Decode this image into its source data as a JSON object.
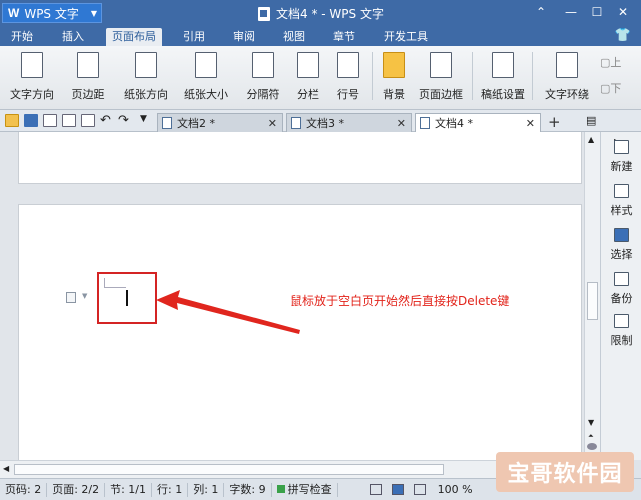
{
  "app": {
    "logo": "W",
    "name": "WPS 文字"
  },
  "window": {
    "title": "文档4 * - WPS 文字"
  },
  "menu": [
    {
      "label": "开始"
    },
    {
      "label": "插入"
    },
    {
      "label": "页面布局"
    },
    {
      "label": "引用"
    },
    {
      "label": "审阅"
    },
    {
      "label": "视图"
    },
    {
      "label": "章节"
    },
    {
      "label": "开发工具"
    }
  ],
  "active_menu": "页面布局",
  "ribbon": [
    {
      "label": "文字方向",
      "icon": "text-direction-icon"
    },
    {
      "label": "页边距",
      "icon": "page-margin-icon"
    },
    {
      "label": "纸张方向",
      "icon": "paper-orientation-icon"
    },
    {
      "label": "纸张大小",
      "icon": "paper-size-icon"
    },
    {
      "label": "分隔符",
      "icon": "separator-icon"
    },
    {
      "label": "分栏",
      "icon": "columns-icon"
    },
    {
      "label": "行号",
      "icon": "line-number-icon"
    },
    {
      "label": "背景",
      "icon": "background-icon"
    },
    {
      "label": "页面边框",
      "icon": "page-border-icon"
    },
    {
      "label": "稿纸设置",
      "icon": "manuscript-icon"
    },
    {
      "label": "文字环绕",
      "icon": "text-wrap-icon"
    }
  ],
  "ribbon_right": [
    "上",
    "下"
  ],
  "tabs": [
    {
      "label": "文档2 *",
      "active": false
    },
    {
      "label": "文档3 *",
      "active": false
    },
    {
      "label": "文档4 *",
      "active": true
    }
  ],
  "side_panel": [
    {
      "label": "新建",
      "icon": "new-icon"
    },
    {
      "label": "样式",
      "icon": "style-icon"
    },
    {
      "label": "选择",
      "icon": "select-icon"
    },
    {
      "label": "备份",
      "icon": "backup-icon"
    },
    {
      "label": "限制",
      "icon": "restrict-icon"
    }
  ],
  "annotation": "鼠标放于空白页开始然后直接按Delete键",
  "status": {
    "page_code": "页码: 2",
    "page": "页面: 2/2",
    "section": "节: 1/1",
    "row": "行: 1",
    "col": "列: 1",
    "words": "字数: 9",
    "spell": "拼写检查",
    "zoom": "100 %"
  },
  "watermark": "宝哥软件园",
  "colors": {
    "title_bar": "#3e6aa6",
    "app_button": "#2f78d3",
    "annotation": "#e2231a",
    "highlight_box": "#d42424"
  }
}
